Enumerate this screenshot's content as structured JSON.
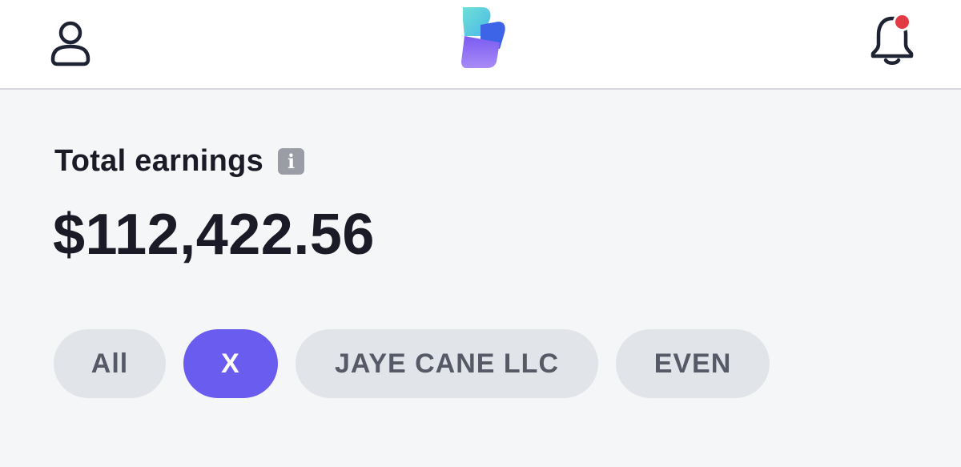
{
  "header": {
    "profile_icon": "user-icon",
    "logo_icon": "brand-logo",
    "notifications_icon": "bell-icon",
    "has_unread_notifications": true
  },
  "earnings": {
    "label": "Total earnings",
    "info_icon": "info-icon",
    "info_glyph": "i",
    "amount": "$112,422.56"
  },
  "filters": {
    "selected": "X",
    "chips": [
      {
        "label": "All"
      },
      {
        "label": "X"
      },
      {
        "label": "JAYE CANE LLC"
      },
      {
        "label": "EVEN"
      }
    ]
  },
  "colors": {
    "accent": "#6b5cf0",
    "chip_bg": "#e1e4e9",
    "notification_dot": "#e23b44",
    "background": "#f5f6f8"
  }
}
